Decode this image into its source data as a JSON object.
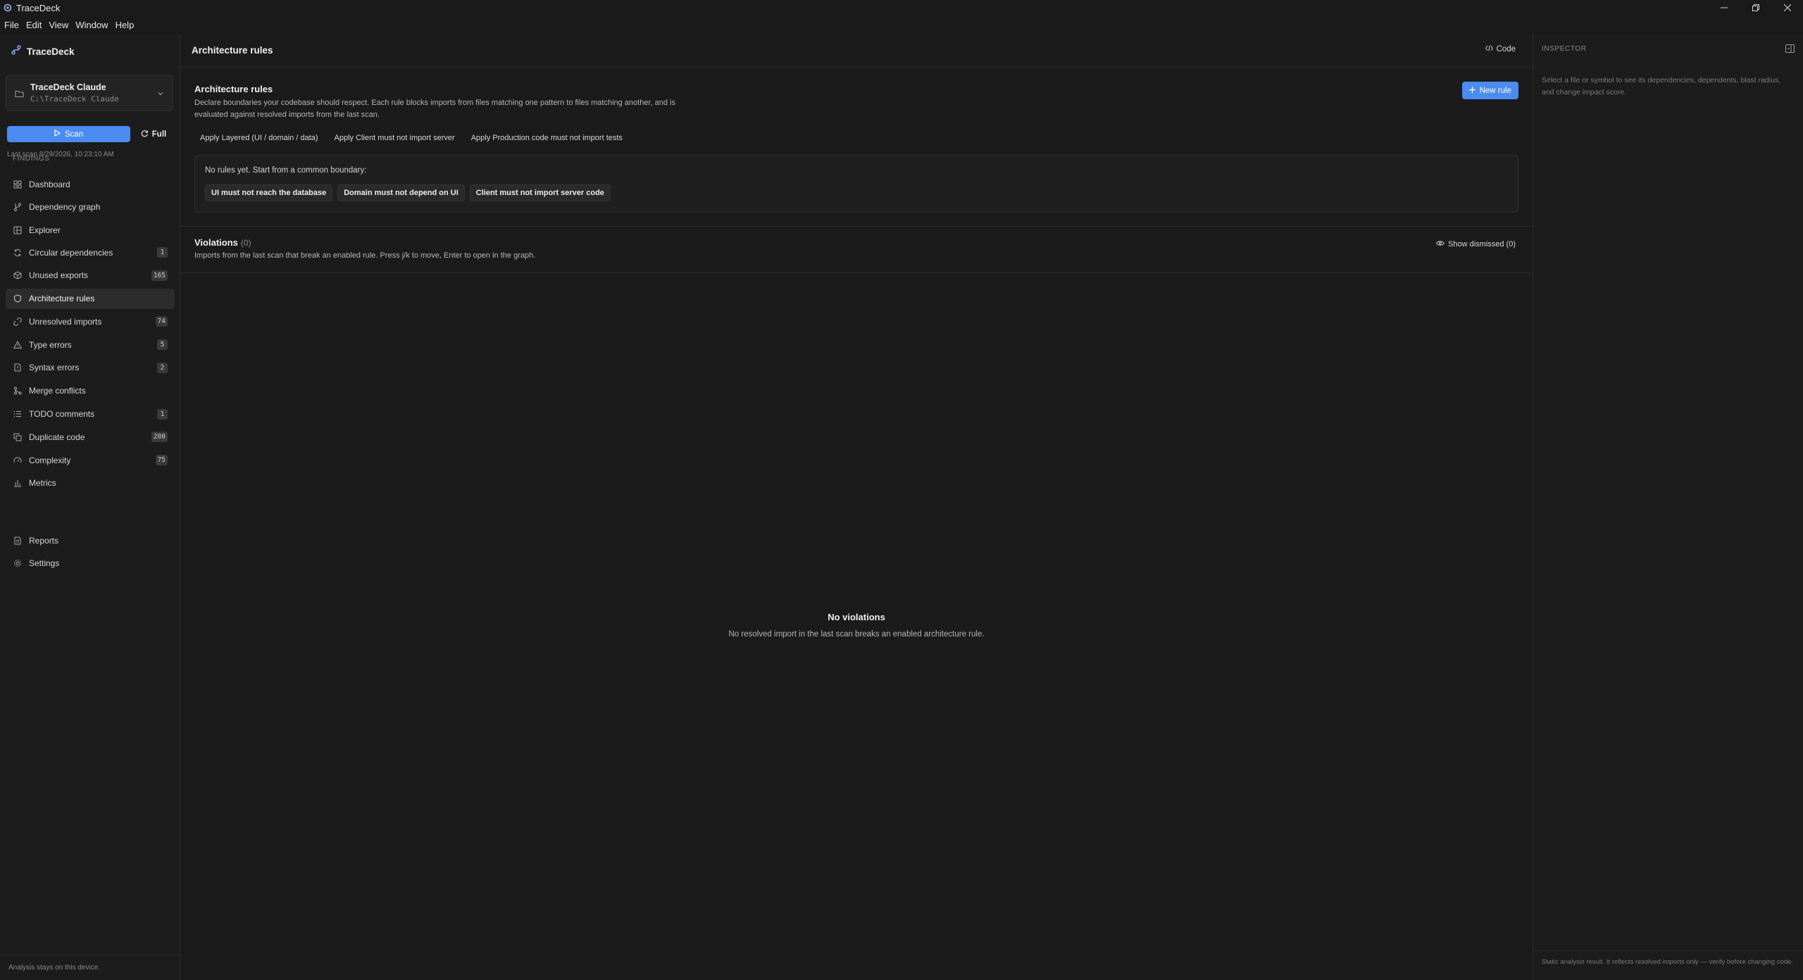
{
  "window": {
    "title": "TraceDeck",
    "controls": [
      "minimize-icon",
      "restore-icon",
      "close-icon"
    ]
  },
  "menu": [
    "File",
    "Edit",
    "View",
    "Window",
    "Help"
  ],
  "sidebar": {
    "brand": "TraceDeck",
    "project": {
      "name": "TraceDeck Claude",
      "path": "C:\\TraceDeck Claude"
    },
    "scan_label": "Scan",
    "full_label": "Full",
    "last_scan": "Last scan 8/29/2026, 10:23:10 AM",
    "nav": [
      {
        "label": "Dashboard",
        "icon": "dashboard-icon"
      },
      {
        "label": "Dependency graph",
        "icon": "graph-icon"
      },
      {
        "label": "Explorer",
        "icon": "explorer-icon"
      }
    ],
    "findings_label": "FINDINGS",
    "findings": [
      {
        "label": "Circular dependencies",
        "icon": "cycle-icon",
        "badge": "1"
      },
      {
        "label": "Unused exports",
        "icon": "package-icon",
        "badge": "165"
      },
      {
        "label": "Architecture rules",
        "icon": "shield-icon",
        "badge": "",
        "active": true
      },
      {
        "label": "Unresolved imports",
        "icon": "unlink-icon",
        "badge": "74"
      },
      {
        "label": "Type errors",
        "icon": "warning-icon",
        "badge": "5"
      },
      {
        "label": "Syntax errors",
        "icon": "file-error-icon",
        "badge": "2"
      },
      {
        "label": "Merge conflicts",
        "icon": "merge-icon",
        "badge": ""
      },
      {
        "label": "TODO comments",
        "icon": "list-icon",
        "badge": "1"
      },
      {
        "label": "Duplicate code",
        "icon": "copy-icon",
        "badge": "200"
      },
      {
        "label": "Complexity",
        "icon": "gauge-icon",
        "badge": "75"
      },
      {
        "label": "Metrics",
        "icon": "bar-chart-icon",
        "badge": ""
      }
    ],
    "bottom_nav": [
      {
        "label": "Reports",
        "icon": "report-icon"
      },
      {
        "label": "Settings",
        "icon": "gear-icon"
      }
    ],
    "footer": "Analysis stays on this device."
  },
  "main": {
    "title": "Architecture rules",
    "code_label": "Code",
    "rules": {
      "title": "Architecture rules",
      "description": "Declare boundaries your codebase should respect. Each rule blocks imports from files matching one pattern to files matching another, and is evaluated against resolved imports from the last scan.",
      "new_rule_label": "New rule",
      "apply_links": [
        "Apply Layered (UI / domain / data)",
        "Apply Client must not import server",
        "Apply Production code must not import tests"
      ],
      "empty_text": "No rules yet. Start from a common boundary:",
      "presets": [
        "UI must not reach the database",
        "Domain must not depend on UI",
        "Client must not import server code"
      ]
    },
    "violations": {
      "title": "Violations",
      "count": "(0)",
      "description": "Imports from the last scan that break an enabled rule. Press j/k to move, Enter to open in the graph.",
      "show_dismissed": "Show dismissed (0)",
      "empty_title": "No violations",
      "empty_desc": "No resolved import in the last scan breaks an enabled architecture rule."
    }
  },
  "inspector": {
    "label": "INSPECTOR",
    "hint": "Select a file or symbol to see its dependencies, dependents, blast radius, and change impact score.",
    "footer": "Static analysis result. It reflects resolved imports only — verify before changing code."
  },
  "colors": {
    "accent": "#4a8cf0",
    "background": "#1b1b1b",
    "sidebar": "#1c1c1c"
  }
}
